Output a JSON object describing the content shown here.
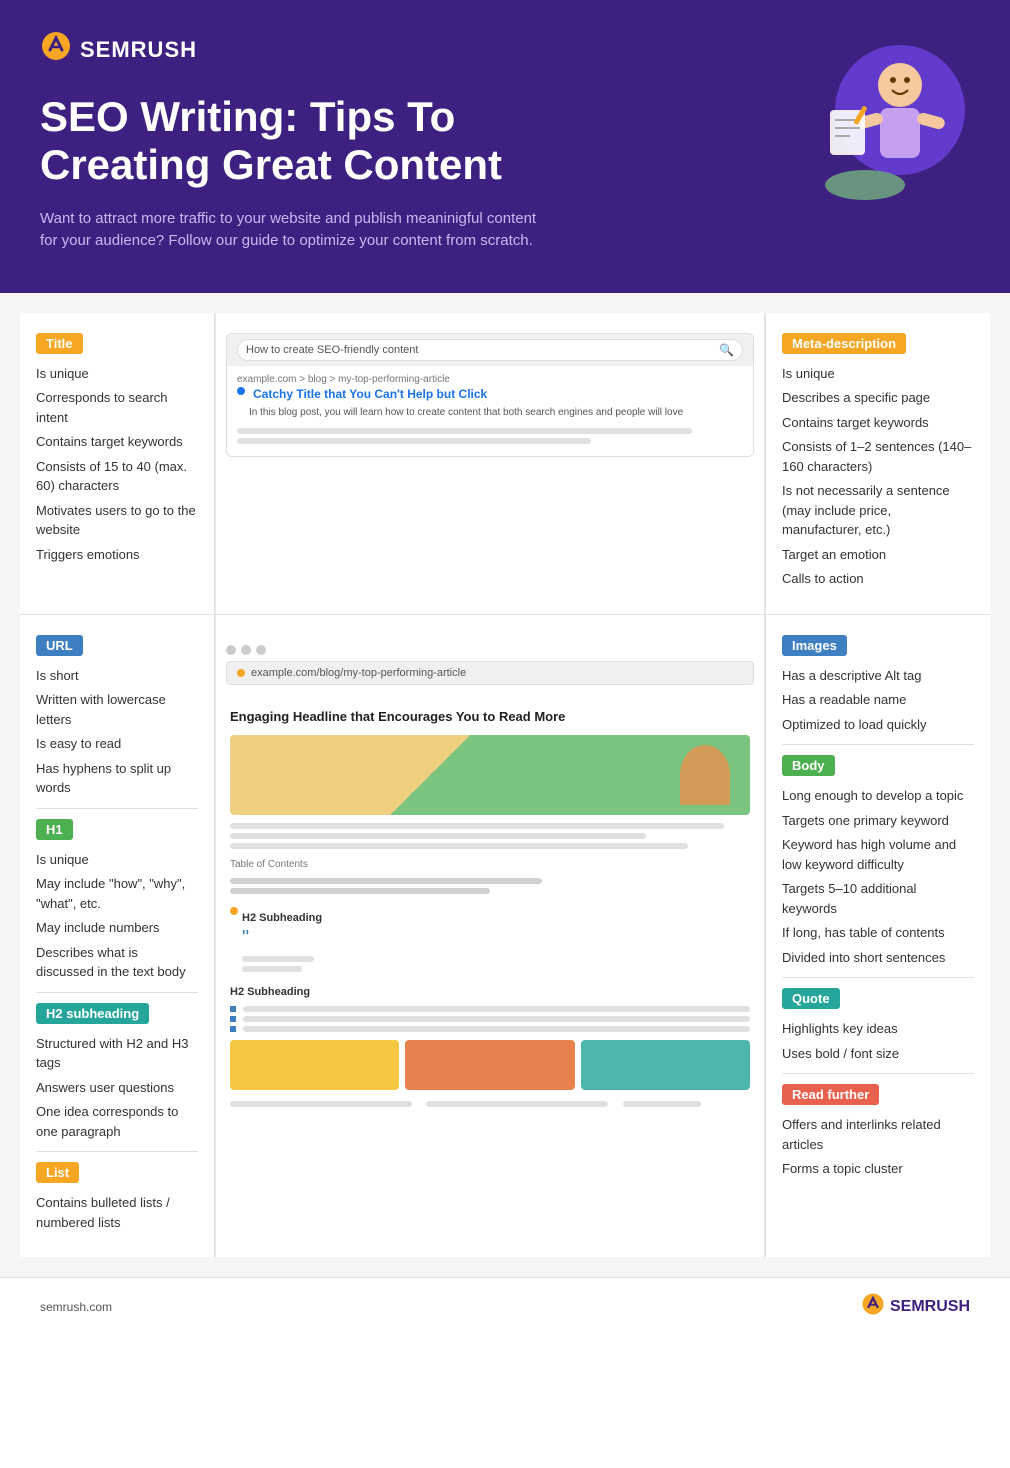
{
  "header": {
    "logo_icon": "⊛",
    "logo_text": "SEMRUSH",
    "title": "SEO Writing: Tips To Creating Great Content",
    "subtitle": "Want to attract more traffic to your website and publish meaninigful content for your audience? Follow our guide to optimize your content from scratch."
  },
  "title_section": {
    "badge": "Title",
    "items": [
      "Is unique",
      "Corresponds to search intent",
      "Contains target keywords",
      "Consists of 15 to 40 (max. 60) characters",
      "Motivates users to go to the website",
      "Triggers emotions"
    ]
  },
  "meta_section": {
    "badge": "Meta-description",
    "items": [
      "Is unique",
      "Describes a specific page",
      "Contains target keywords",
      "Consists of 1–2 sentences (140–160 characters)",
      "Is not necessarily a sentence (may include price, manufacturer, etc.)",
      "Target an emotion",
      "Calls to action"
    ]
  },
  "browser": {
    "search_text": "How to create SEO-friendly content",
    "breadcrumb": "example.com > blog > my-top-performing-article",
    "page_link": "Catchy Title that You Can't Help but Click",
    "page_desc": "In this blog post, you will learn how to create content that both search engines and people will love"
  },
  "url_section": {
    "badge": "URL",
    "items": [
      "Is short",
      "Written with lowercase letters",
      "Is easy to read",
      "Has hyphens to split up words"
    ],
    "url_text": "example.com/blog/my-top-performing-article"
  },
  "h1_section": {
    "badge": "H1",
    "items": [
      "Is unique",
      "May include \"how\", \"why\", \"what\", etc.",
      "May include numbers",
      "Describes what is discussed in the text body"
    ]
  },
  "h2_section": {
    "badge": "H2 subheading",
    "items": [
      "Structured with H2 and H3 tags",
      "Answers user questions",
      "One idea corresponds to one paragraph"
    ]
  },
  "list_section": {
    "badge": "List",
    "items": [
      "Contains bulleted lists / numbered lists"
    ]
  },
  "images_section": {
    "badge": "Images",
    "items": [
      "Has a descriptive Alt tag",
      "Has a readable name",
      "Optimized to load quickly"
    ]
  },
  "body_section": {
    "badge": "Body",
    "items": [
      "Long enough to develop a topic",
      "Targets one primary keyword",
      "Keyword has high volume and low keyword difficulty",
      "Targets 5–10 additional keywords",
      "If long, has table of contents",
      "Divided into short sentences"
    ]
  },
  "quote_section": {
    "badge": "Quote",
    "items": [
      "Highlights key ideas",
      "Uses bold / font size"
    ]
  },
  "read_further_section": {
    "badge": "Read further",
    "items": [
      "Offers and interlinks related articles",
      "Forms a topic cluster"
    ]
  },
  "article_mock": {
    "headline": "Engaging Headline that Encourages You to Read More",
    "toc_label": "Table of Contents",
    "h2_label_1": "H2 Subheading",
    "h2_label_2": "H2 Subheading"
  },
  "footer": {
    "url": "semrush.com",
    "logo_icon": "⊛",
    "logo_text": "SEMRUSH"
  }
}
